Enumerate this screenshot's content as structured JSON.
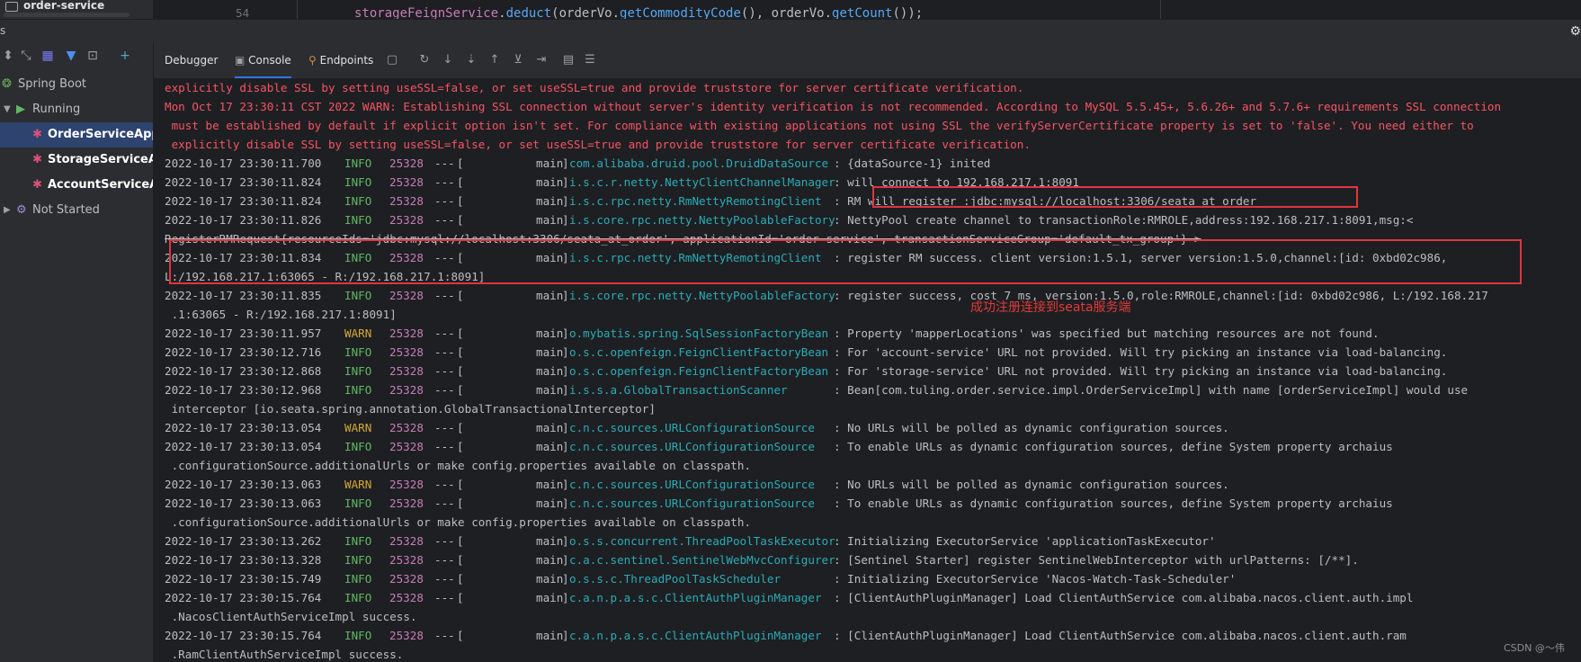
{
  "top": {
    "project_label": "order-service",
    "line_number": "54",
    "code": {
      "var1": "storageFeignService",
      "dot1": ".",
      "m1": "deduct",
      "arg1": "(orderVo.",
      "m2": "getCommodityCode",
      "mid": "(), orderVo.",
      "m3": "getCount",
      "end": "());"
    }
  },
  "tool_window": {
    "title": "s"
  },
  "services": {
    "tree": [
      {
        "label": "Spring Boot",
        "icon": "spring-boot-icon"
      },
      {
        "label": "Running",
        "icon": "running-icon"
      },
      {
        "label": "OrderServiceApplic",
        "icon": "bug-icon"
      },
      {
        "label": "StorageServiceApp",
        "icon": "bug-icon"
      },
      {
        "label": "AccountServiceApp",
        "icon": "bug-icon"
      },
      {
        "label": "Not Started",
        "icon": "gear-icon"
      }
    ]
  },
  "tabs": {
    "debugger": "Debugger",
    "console": "Console",
    "endpoints": "Endpoints"
  },
  "console": {
    "err1": "explicitly disable SSL by setting useSSL=false, or set useSSL=true and provide truststore for server certificate verification.",
    "err2": "Mon Oct 17 23:30:11 CST 2022 WARN: Establishing SSL connection without server's identity verification is not recommended. According to MySQL 5.5.45+, 5.6.26+ and 5.7.6+ requirements SSL connection",
    "err3": " must be established by default if explicit option isn't set. For compliance with existing applications not using SSL the verifyServerCertificate property is set to 'false'. You need either to",
    "err4": " explicitly disable SSL by setting useSSL=false, or set useSSL=true and provide truststore for server certificate verification.",
    "rows": [
      {
        "ts": "2022-10-17 23:30:11.700",
        "lvl": "INFO",
        "pid": "25328",
        "thr": "main",
        "logger": "com.alibaba.druid.pool.DruidDataSource",
        "msg": ": {dataSource-1} inited",
        "cont": ""
      },
      {
        "ts": "2022-10-17 23:30:11.824",
        "lvl": "INFO",
        "pid": "25328",
        "thr": "main",
        "logger": "i.s.c.r.netty.NettyClientChannelManager",
        "msg": ": will connect to 192.168.217.1:8091",
        "cont": ""
      },
      {
        "ts": "2022-10-17 23:30:11.824",
        "lvl": "INFO",
        "pid": "25328",
        "thr": "main",
        "logger": "i.s.c.rpc.netty.RmNettyRemotingClient",
        "msg": ": RM will register :jdbc:mysql://localhost:3306/seata_at_order",
        "cont": ""
      },
      {
        "ts": "2022-10-17 23:30:11.826",
        "lvl": "INFO",
        "pid": "25328",
        "thr": "main",
        "logger": "i.s.core.rpc.netty.NettyPoolableFactory",
        "msg": ": NettyPool create channel to transactionRole:RMROLE,address:192.168.217.1:8091,msg:<",
        "cont": "RegisterRMRequest{resourceIds='jdbc:mysql://localhost:3306/seata_at_order', applicationId='order-service', transactionServiceGroup='default_tx_group'} >"
      },
      {
        "ts": "2022-10-17 23:30:11.834",
        "lvl": "INFO",
        "pid": "25328",
        "thr": "main",
        "logger": "i.s.c.rpc.netty.RmNettyRemotingClient",
        "msg": ": register RM success. client version:1.5.1, server version:1.5.0,channel:[id: 0xbd02c986,",
        "cont": "L:/192.168.217.1:63065 - R:/192.168.217.1:8091]"
      },
      {
        "ts": "2022-10-17 23:30:11.835",
        "lvl": "INFO",
        "pid": "25328",
        "thr": "main",
        "logger": "i.s.core.rpc.netty.NettyPoolableFactory",
        "msg": ": register success, cost 7 ms, version:1.5.0,role:RMROLE,channel:[id: 0xbd02c986, L:/192.168.217",
        "cont": " .1:63065 - R:/192.168.217.1:8091]"
      },
      {
        "ts": "2022-10-17 23:30:11.957",
        "lvl": "WARN",
        "pid": "25328",
        "thr": "main",
        "logger": "o.mybatis.spring.SqlSessionFactoryBean",
        "msg": ": Property 'mapperLocations' was specified but matching resources are not found.",
        "cont": ""
      },
      {
        "ts": "2022-10-17 23:30:12.716",
        "lvl": "INFO",
        "pid": "25328",
        "thr": "main",
        "logger": "o.s.c.openfeign.FeignClientFactoryBean",
        "msg": ": For 'account-service' URL not provided. Will try picking an instance via load-balancing.",
        "cont": ""
      },
      {
        "ts": "2022-10-17 23:30:12.868",
        "lvl": "INFO",
        "pid": "25328",
        "thr": "main",
        "logger": "o.s.c.openfeign.FeignClientFactoryBean",
        "msg": ": For 'storage-service' URL not provided. Will try picking an instance via load-balancing.",
        "cont": ""
      },
      {
        "ts": "2022-10-17 23:30:12.968",
        "lvl": "INFO",
        "pid": "25328",
        "thr": "main",
        "logger": "i.s.s.a.GlobalTransactionScanner",
        "msg": ": Bean[com.tuling.order.service.impl.OrderServiceImpl] with name [orderServiceImpl] would use",
        "cont": " interceptor [io.seata.spring.annotation.GlobalTransactionalInterceptor]"
      },
      {
        "ts": "2022-10-17 23:30:13.054",
        "lvl": "WARN",
        "pid": "25328",
        "thr": "main",
        "logger": "c.n.c.sources.URLConfigurationSource",
        "msg": ": No URLs will be polled as dynamic configuration sources.",
        "cont": ""
      },
      {
        "ts": "2022-10-17 23:30:13.054",
        "lvl": "INFO",
        "pid": "25328",
        "thr": "main",
        "logger": "c.n.c.sources.URLConfigurationSource",
        "msg": ": To enable URLs as dynamic configuration sources, define System property archaius",
        "cont": " .configurationSource.additionalUrls or make config.properties available on classpath."
      },
      {
        "ts": "2022-10-17 23:30:13.063",
        "lvl": "WARN",
        "pid": "25328",
        "thr": "main",
        "logger": "c.n.c.sources.URLConfigurationSource",
        "msg": ": No URLs will be polled as dynamic configuration sources.",
        "cont": ""
      },
      {
        "ts": "2022-10-17 23:30:13.063",
        "lvl": "INFO",
        "pid": "25328",
        "thr": "main",
        "logger": "c.n.c.sources.URLConfigurationSource",
        "msg": ": To enable URLs as dynamic configuration sources, define System property archaius",
        "cont": " .configurationSource.additionalUrls or make config.properties available on classpath."
      },
      {
        "ts": "2022-10-17 23:30:13.262",
        "lvl": "INFO",
        "pid": "25328",
        "thr": "main",
        "logger": "o.s.s.concurrent.ThreadPoolTaskExecutor",
        "msg": ": Initializing ExecutorService 'applicationTaskExecutor'",
        "cont": ""
      },
      {
        "ts": "2022-10-17 23:30:13.328",
        "lvl": "INFO",
        "pid": "25328",
        "thr": "main",
        "logger": "c.a.c.sentinel.SentinelWebMvcConfigurer",
        "msg": ": [Sentinel Starter] register SentinelWebInterceptor with urlPatterns: [/**].",
        "cont": ""
      },
      {
        "ts": "2022-10-17 23:30:15.749",
        "lvl": "INFO",
        "pid": "25328",
        "thr": "main",
        "logger": "o.s.s.c.ThreadPoolTaskScheduler",
        "msg": ": Initializing ExecutorService 'Nacos-Watch-Task-Scheduler'",
        "cont": ""
      },
      {
        "ts": "2022-10-17 23:30:15.764",
        "lvl": "INFO",
        "pid": "25328",
        "thr": "main",
        "logger": "c.a.n.p.a.s.c.ClientAuthPluginManager",
        "msg": ": [ClientAuthPluginManager] Load ClientAuthService com.alibaba.nacos.client.auth.impl",
        "cont": " .NacosClientAuthServiceImpl success."
      },
      {
        "ts": "2022-10-17 23:30:15.764",
        "lvl": "INFO",
        "pid": "25328",
        "thr": "main",
        "logger": "c.a.n.p.a.s.c.ClientAuthPluginManager",
        "msg": ": [ClientAuthPluginManager] Load ClientAuthService com.alibaba.nacos.client.auth.ram",
        "cont": " .RamClientAuthServiceImpl success."
      }
    ],
    "annotation": "成功注册连接到seata服务端",
    "watermark": "CSDN @～伟"
  }
}
